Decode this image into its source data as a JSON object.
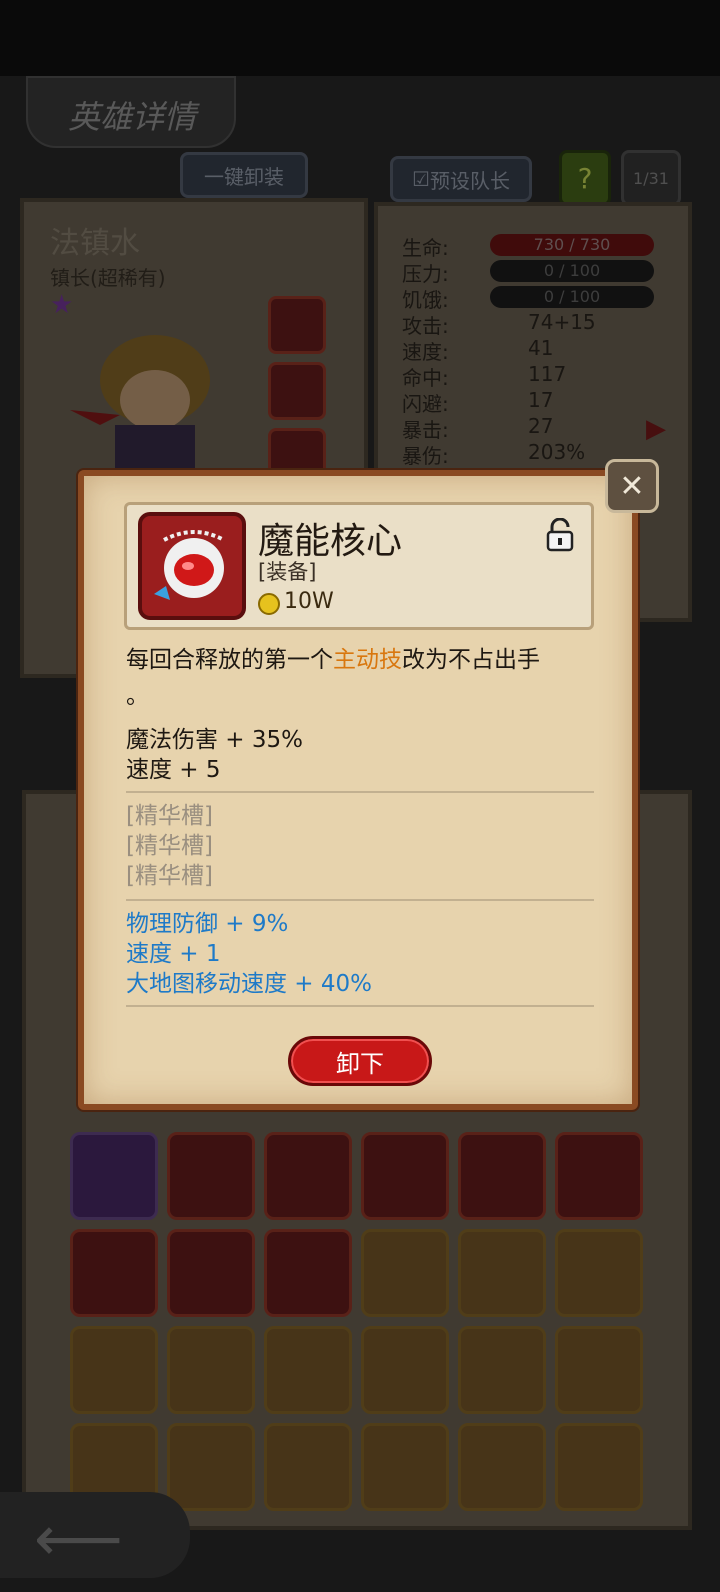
{
  "header": {
    "title": "英雄详情"
  },
  "tabs": {
    "unequip_all": "一键卸装",
    "preset_captain": "预设队长",
    "help": "?",
    "page": "1/31"
  },
  "hero": {
    "name": "法镇水",
    "title": "镇长(超稀有)"
  },
  "stats": [
    {
      "label": "生命:",
      "value": "730 / 730",
      "kind": "bar-red"
    },
    {
      "label": "压力:",
      "value": "0 / 100",
      "kind": "bar"
    },
    {
      "label": "饥饿:",
      "value": "0 / 100",
      "kind": "bar"
    },
    {
      "label": "攻击:",
      "value": "74+15"
    },
    {
      "label": "速度:",
      "value": "41"
    },
    {
      "label": "命中:",
      "value": "117"
    },
    {
      "label": "闪避:",
      "value": "17"
    },
    {
      "label": "暴击:",
      "value": "27"
    },
    {
      "label": "暴伤:",
      "value": "203%"
    }
  ],
  "item_popup": {
    "name": "魔能核心",
    "type": "[装备]",
    "price": "10W",
    "desc_before": "每回合释放的第一个",
    "desc_highlight": "主动技",
    "desc_after": "改为不占出手",
    "desc_end": "。",
    "base_stats": [
      "魔法伤害 + 35%",
      "速度 + 5"
    ],
    "essence_slots": [
      "[精华槽]",
      "[精华槽]",
      "[精华槽]"
    ],
    "bonus_stats": [
      "物理防御 + 9%",
      "速度 + 1",
      "大地图移动速度 + 40%"
    ],
    "unequip_label": "卸下",
    "colors": {
      "highlight": "#d9770e",
      "bonus": "#1e7ac8",
      "button": "#c81818"
    }
  }
}
